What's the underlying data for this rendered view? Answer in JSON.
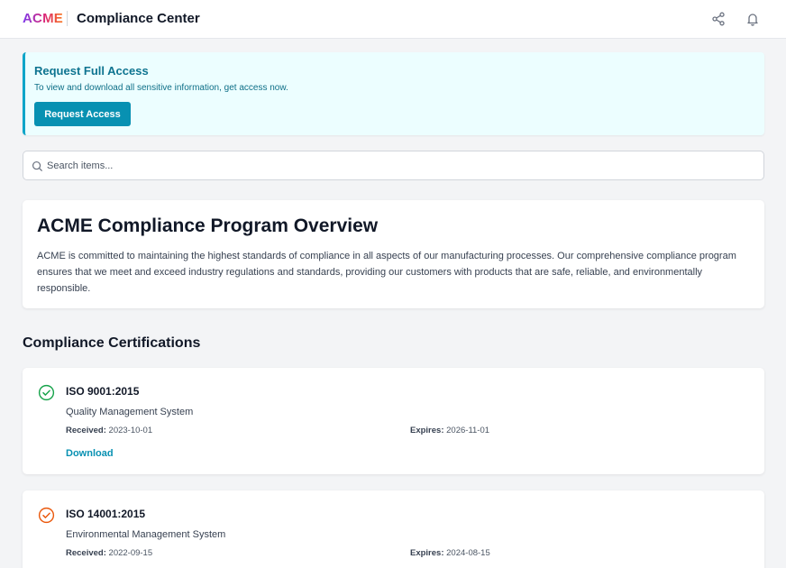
{
  "header": {
    "logo_text": "ACME",
    "app_title": "Compliance Center",
    "icons": [
      "share-icon",
      "bell-icon"
    ]
  },
  "banner": {
    "title": "Request Full Access",
    "text": "To view and download all sensitive information, get access now.",
    "button_label": "Request Access",
    "accent_color": "#0891b2"
  },
  "search": {
    "placeholder": "Search items...",
    "value": ""
  },
  "overview": {
    "title": "ACME Compliance Program Overview",
    "text": "ACME is committed to maintaining the highest standards of compliance in all aspects of our manufacturing processes. Our comprehensive compliance program ensures that we meet and exceed industry regulations and standards, providing our customers with products that are safe, reliable, and environmentally responsible."
  },
  "certifications": {
    "section_title": "Compliance Certifications",
    "received_label": "Received:",
    "expires_label": "Expires:",
    "items": [
      {
        "name": "ISO 9001:2015",
        "description": "Quality Management System",
        "received": "2023-10-01",
        "expires": "2026-11-01",
        "status_color": "#16a34a",
        "download_label": "Download"
      },
      {
        "name": "ISO 14001:2015",
        "description": "Environmental Management System",
        "received": "2022-09-15",
        "expires": "2024-08-15",
        "status_color": "#ea580c"
      }
    ]
  }
}
